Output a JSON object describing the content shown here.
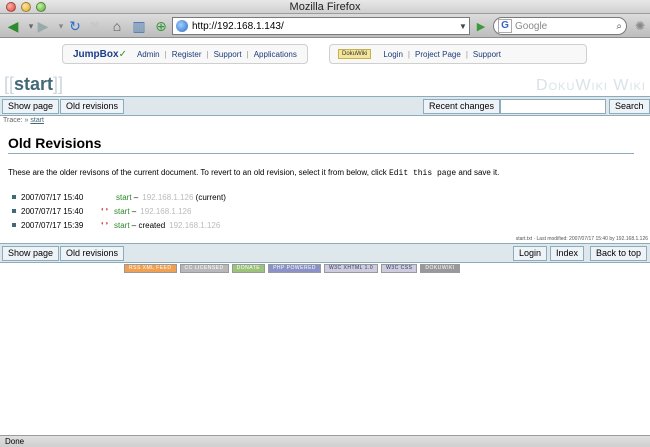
{
  "window": {
    "title": "Mozilla Firefox"
  },
  "browser": {
    "url": "http://192.168.1.143/",
    "search_placeholder": "Google",
    "status": "Done"
  },
  "jumpbox": {
    "logo_text": "JumpBox",
    "links_left": [
      "Admin",
      "Register",
      "Support",
      "Applications"
    ],
    "badge": "DokuWiki",
    "links_right": [
      "Login",
      "Project Page",
      "Support"
    ]
  },
  "wiki": {
    "pagename": "start",
    "site_title": "DokuWiki Wiki",
    "top_buttons": {
      "show_page": "Show page",
      "old_revisions": "Old revisions",
      "recent_changes": "Recent changes",
      "search": "Search"
    },
    "breadcrumb_label": "Trace:",
    "breadcrumb_item": "start",
    "heading": "Old Revisions",
    "intro_before": "These are the older revisons of the current document. To revert to an old revision, select it from below, click",
    "intro_code": "Edit this page",
    "intro_after": "and save it.",
    "revisions": [
      {
        "date": "2007/07/17 15:40",
        "page": "start",
        "sep": "–",
        "ip": "192.168.1.126",
        "note": "(current)"
      },
      {
        "date": "2007/07/17 15:40",
        "page": "start",
        "sep": "–",
        "ip": "192.168.1.126",
        "note": ""
      },
      {
        "date": "2007/07/17 15:39",
        "page": "start",
        "sep": "– created",
        "ip": "192.168.1.126",
        "note": ""
      }
    ],
    "meta": "start.txt · Last modified: 2007/07/17 15:40 by 192.168.1.126",
    "bottom_buttons": {
      "show_page": "Show page",
      "old_revisions": "Old revisions",
      "login": "Login",
      "index": "Index",
      "back_to_top": "Back to top"
    },
    "badges": [
      "RSS XML FEED",
      "CC LICENSED",
      "DONATE",
      "PHP POWERED",
      "W3C XHTML 1.0",
      "W3C CSS",
      "DOKUWIKI"
    ]
  },
  "colors": {
    "accent": "#436976",
    "bar_bg": "#dee7ec",
    "link_green": "#2a8a2a"
  }
}
